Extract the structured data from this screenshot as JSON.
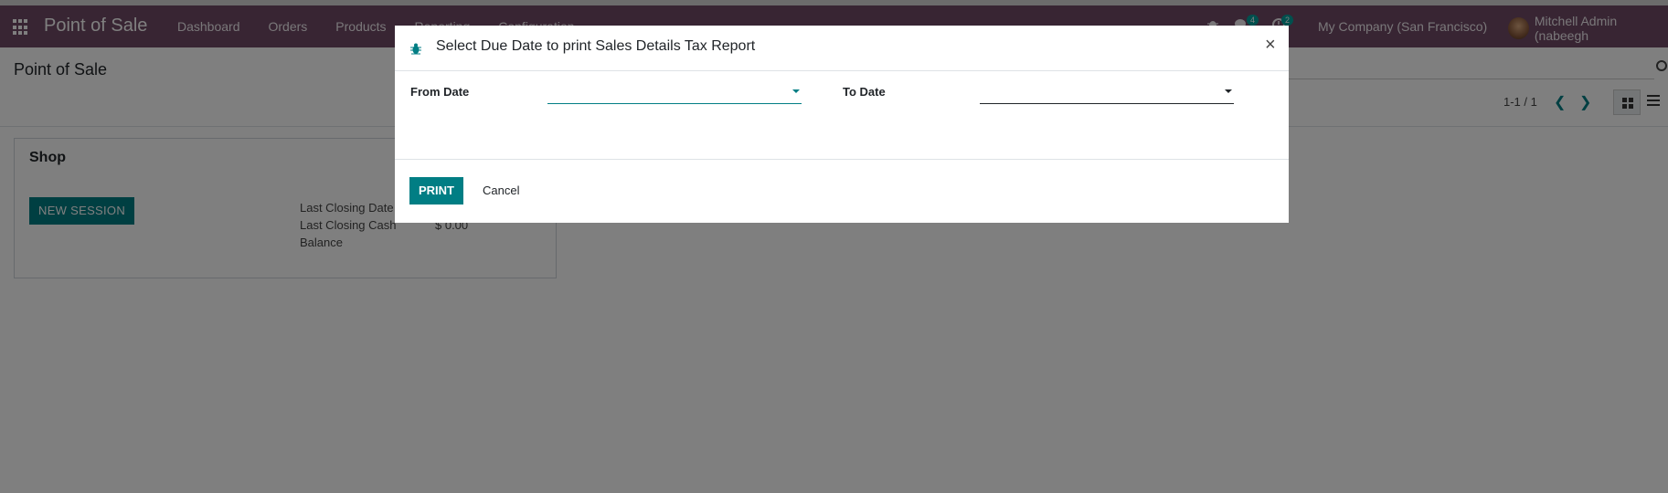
{
  "navbar": {
    "brand": "Point of Sale",
    "menu": [
      "Dashboard",
      "Orders",
      "Products",
      "Reporting",
      "Configuration"
    ],
    "chat_badge": "4",
    "activity_badge": "2",
    "company": "My Company (San Francisco)",
    "user": "Mitchell Admin (nabeegh"
  },
  "control_panel": {
    "title": "Point of Sale",
    "pager": "1-1 / 1"
  },
  "card": {
    "title": "Shop",
    "button": "NEW SESSION",
    "label_closing_date": "Last Closing Date",
    "label_closing_cash": "Last Closing Cash",
    "label_balance": "Balance",
    "closing_cash_value": "$ 0.00"
  },
  "modal": {
    "title": "Select Due Date to print Sales Details Tax Report",
    "close": "×",
    "from_label": "From Date",
    "to_label": "To Date",
    "from_value": "",
    "to_value": "",
    "print_label": "PRINT",
    "cancel_label": "Cancel"
  },
  "colors": {
    "navbar": "#714b67",
    "primary": "#017e84",
    "badge": "#00a09d"
  }
}
